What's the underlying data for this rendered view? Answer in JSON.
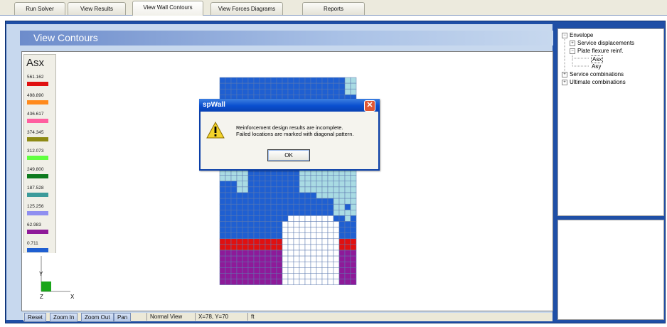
{
  "tabs": [
    {
      "label": "Run Solver",
      "active": false
    },
    {
      "label": "View Results",
      "active": false
    },
    {
      "label": "View Wall Contours",
      "active": true
    },
    {
      "label": "View Forces Diagrams",
      "active": false
    },
    {
      "label": "Reports",
      "active": false
    }
  ],
  "panel": {
    "title": "View Contours"
  },
  "legend": {
    "title": "Asx",
    "entries": [
      {
        "value": "561.162",
        "color": "#e01010"
      },
      {
        "value": "498.890",
        "color": "#ff8a1c"
      },
      {
        "value": "436.617",
        "color": "#ff5fa0"
      },
      {
        "value": "374.345",
        "color": "#8e8a15"
      },
      {
        "value": "312.073",
        "color": "#60ff40"
      },
      {
        "value": "249.800",
        "color": "#0d7a1e"
      },
      {
        "value": "187.528",
        "color": "#3c9b9b"
      },
      {
        "value": "125.256",
        "color": "#8f8ff0"
      },
      {
        "value": "62.983",
        "color": "#8e1a99"
      },
      {
        "value": "0.711",
        "color": "#1f5fd1"
      }
    ]
  },
  "axis": {
    "y_label": "Y",
    "z_label": "Z",
    "x_label": "X"
  },
  "tree": {
    "items": [
      {
        "label": "Envelope",
        "toggle": "−"
      },
      {
        "label": "Service displacements",
        "toggle": "+"
      },
      {
        "label": "Plate flexure reinf.",
        "toggle": "−"
      },
      {
        "label": "Asx",
        "toggle": ""
      },
      {
        "label": "Asy",
        "toggle": ""
      },
      {
        "label": "Service combinations",
        "toggle": "+"
      },
      {
        "label": "Ultimate combinations",
        "toggle": "+"
      }
    ]
  },
  "statusbar": {
    "reset": "Reset",
    "zoom_in": "Zoom In",
    "zoom_out": "Zoom Out",
    "pan": "Pan",
    "view_mode": "Normal View",
    "coords": "X=78, Y=70",
    "units": "ft"
  },
  "dialog": {
    "title": "spWall",
    "message_line1": "Reinforcement design results are incomplete.",
    "message_line2": "Failed locations are marked with diagonal pattern.",
    "ok_label": "OK",
    "close_glyph": "✕"
  },
  "colors": {
    "blue": "#1f5fd1",
    "light": "#a9dbe3",
    "red": "#e01010",
    "purple": "#8e1a99",
    "white": "#ffffff",
    "frame": "#1f4fa6"
  }
}
